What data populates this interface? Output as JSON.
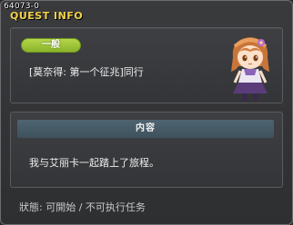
{
  "window": {
    "quest_id": "64073-0",
    "title": "QUEST INFO"
  },
  "quest": {
    "category": "一般",
    "name": "[莫奈得: 第一个征兆]同行",
    "portrait_icon": "character-portrait-icon"
  },
  "content": {
    "header": "内容",
    "text": "我与艾丽卡一起踏上了旅程。"
  },
  "status": {
    "text": "狀態: 可開始 / 不可执行任务"
  },
  "colors": {
    "title": "#f2d24b",
    "badge": "#9cc236",
    "content_header": "#465b66"
  }
}
